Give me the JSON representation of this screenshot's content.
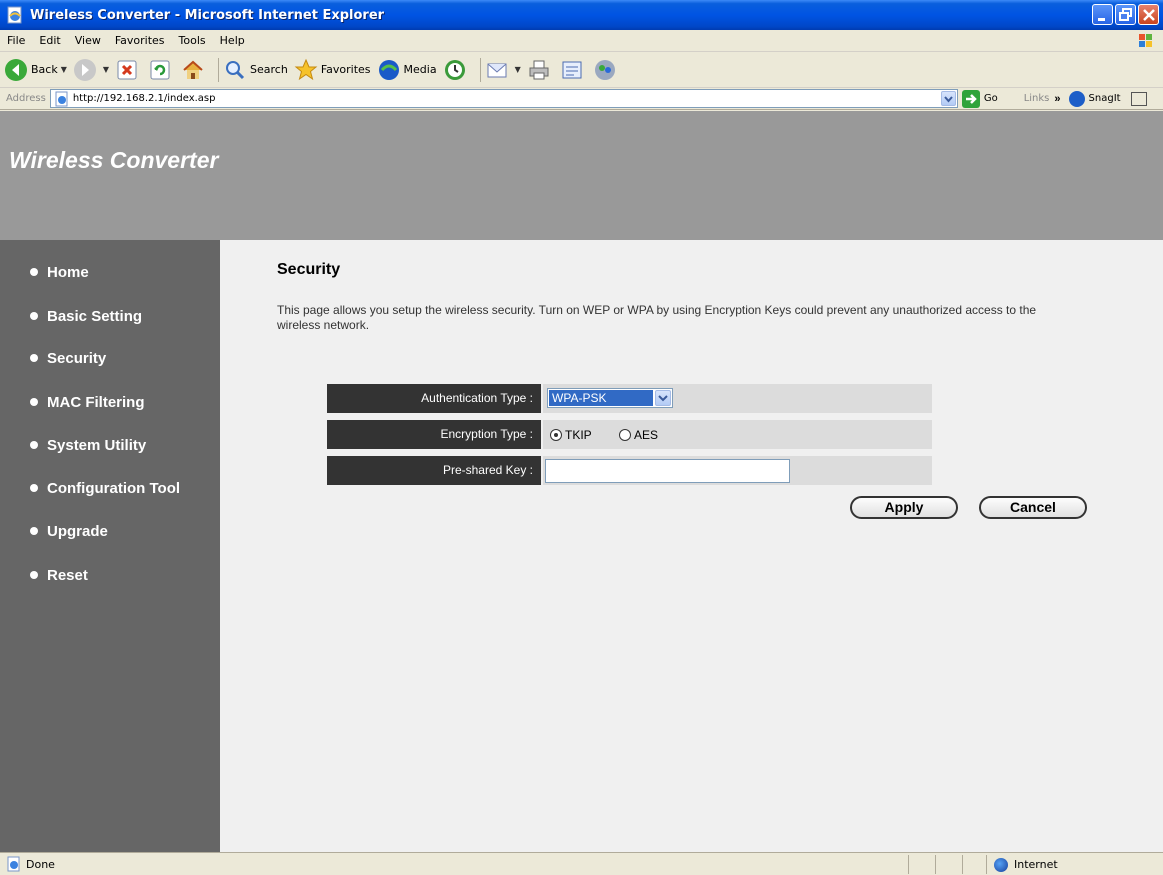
{
  "window": {
    "title": "Wireless Converter - Microsoft Internet Explorer",
    "buttons": [
      "minimize",
      "maximize",
      "close"
    ]
  },
  "menu": {
    "items": [
      "File",
      "Edit",
      "View",
      "Favorites",
      "Tools",
      "Help"
    ]
  },
  "toolbar": {
    "back_label": "Back",
    "search_label": "Search",
    "favorites_label": "Favorites",
    "media_label": "Media"
  },
  "address": {
    "label": "Address",
    "url": "http://192.168.2.1/index.asp",
    "go_label": "Go",
    "links_label": "Links",
    "chevron": "»",
    "snagit_label": "SnagIt"
  },
  "banner": {
    "brand": "Wireless Converter"
  },
  "sidebar": {
    "items": [
      {
        "label": "Home"
      },
      {
        "label": "Basic Setting"
      },
      {
        "label": "Security"
      },
      {
        "label": "MAC Filtering"
      },
      {
        "label": "System Utility"
      },
      {
        "label": "Configuration Tool"
      },
      {
        "label": "Upgrade"
      },
      {
        "label": "Reset"
      }
    ]
  },
  "content": {
    "title": "Security",
    "description": "This page allows you setup the wireless security. Turn on WEP or WPA by using Encryption Keys could prevent any unauthorized access to the wireless network.",
    "form": {
      "auth_label": "Authentication Type :",
      "auth_value": "WPA-PSK",
      "enc_label": "Encryption Type :",
      "enc_options": [
        "TKIP",
        "AES"
      ],
      "enc_selected": "TKIP",
      "psk_label": "Pre-shared Key :",
      "psk_value": ""
    },
    "buttons": {
      "apply": "Apply",
      "cancel": "Cancel"
    }
  },
  "status": {
    "text": "Done",
    "zone": "Internet"
  },
  "colors": {
    "banner": "#999999",
    "sidebar": "#666666",
    "label_bg": "#333333",
    "value_bg": "#dcdcdc",
    "selection": "#316ac5"
  }
}
